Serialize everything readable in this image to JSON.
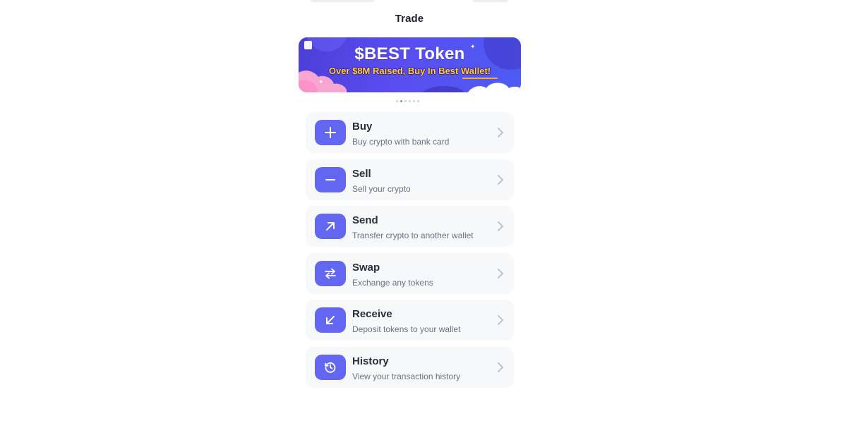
{
  "header": {
    "title": "Trade"
  },
  "banner": {
    "title": "$BEST Token",
    "subtitle": "Over $8M Raised, Buy In Best Wallet!",
    "colors": {
      "background": "#5247e8",
      "title": "#ffffff",
      "subtitle": "#ffd23a"
    }
  },
  "pagination": {
    "count": 6,
    "active_index": 1
  },
  "accent_color": "#6366f1",
  "menu": {
    "items": [
      {
        "label": "Buy",
        "description": "Buy crypto with bank card",
        "icon": "plus-icon"
      },
      {
        "label": "Sell",
        "description": "Sell your crypto",
        "icon": "minus-icon"
      },
      {
        "label": "Send",
        "description": "Transfer crypto to another wallet",
        "icon": "arrow-up-right-icon"
      },
      {
        "label": "Swap",
        "description": "Exchange any tokens",
        "icon": "swap-arrows-icon"
      },
      {
        "label": "Receive",
        "description": "Deposit tokens to your wallet",
        "icon": "arrow-down-left-icon"
      },
      {
        "label": "History",
        "description": "View your transaction history",
        "icon": "history-icon"
      }
    ]
  }
}
